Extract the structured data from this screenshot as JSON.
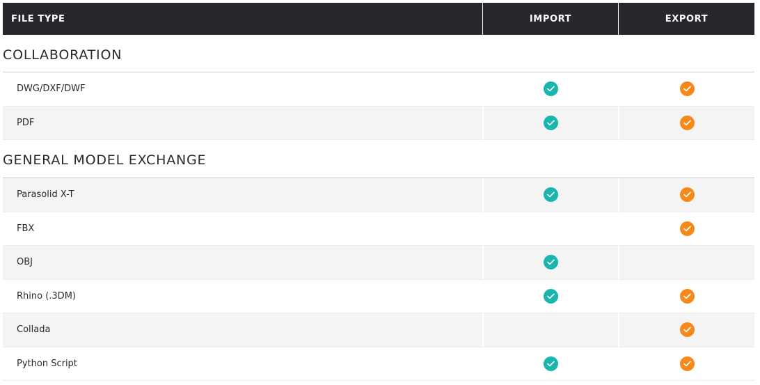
{
  "header": {
    "file_type": "FILE TYPE",
    "import": "IMPORT",
    "export": "EXPORT"
  },
  "colors": {
    "import_check": "#19b6b0",
    "export_check": "#f7891b",
    "header_bg": "#26272b"
  },
  "sections": [
    {
      "title": "COLLABORATION",
      "rows": [
        {
          "name": "DWG/DXF/DWF",
          "import": true,
          "export": true
        },
        {
          "name": "PDF",
          "import": true,
          "export": true
        }
      ]
    },
    {
      "title": "GENERAL MODEL EXCHANGE",
      "rows": [
        {
          "name": "Parasolid X-T",
          "import": true,
          "export": true
        },
        {
          "name": "FBX",
          "import": false,
          "export": true
        },
        {
          "name": "OBJ",
          "import": true,
          "export": false
        },
        {
          "name": "Rhino (.3DM)",
          "import": true,
          "export": true
        },
        {
          "name": "Collada",
          "import": false,
          "export": true
        },
        {
          "name": "Python Script",
          "import": true,
          "export": true
        }
      ]
    }
  ]
}
